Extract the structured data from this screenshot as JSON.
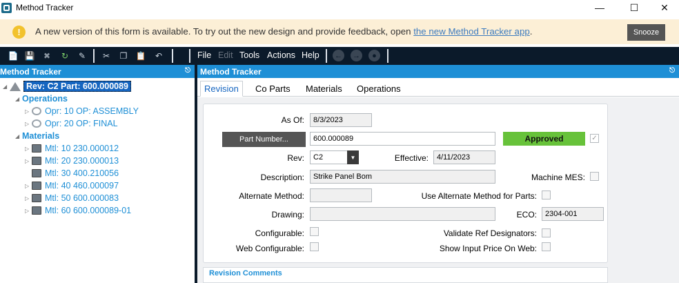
{
  "window": {
    "title": "Method Tracker"
  },
  "banner": {
    "text": "A new version of this form is available. To try out the new design and provide feedback, open ",
    "link": "the new Method Tracker app",
    "end": ".",
    "snooze": "Snooze"
  },
  "menu": {
    "file": "File",
    "edit": "Edit",
    "tools": "Tools",
    "actions": "Actions",
    "help": "Help"
  },
  "left_panel": {
    "title": "Method Tracker",
    "root": "Rev: C2 Part: 600.000089",
    "operations_label": "Operations",
    "operations": [
      "Opr: 10 OP: ASSEMBLY",
      "Opr: 20 OP: FINAL"
    ],
    "materials_label": "Materials",
    "materials": [
      "Mtl: 10 230.000012",
      "Mtl: 20 230.000013",
      "Mtl: 30 400.210056",
      "Mtl: 40 460.000097",
      "Mtl: 50 600.000083",
      "Mtl: 60 600.000089-01"
    ]
  },
  "right_panel": {
    "title": "Method Tracker",
    "tabs": [
      "Revision",
      "Co Parts",
      "Materials",
      "Operations"
    ],
    "active_tab": "Revision"
  },
  "form": {
    "as_of_label": "As Of:",
    "as_of": "8/3/2023",
    "part_number_button": "Part Number...",
    "part_number": "600.000089",
    "status": "Approved",
    "rev_label": "Rev:",
    "rev": "C2",
    "effective_label": "Effective:",
    "effective": "4/11/2023",
    "description_label": "Description:",
    "description": "Strike Panel Bom",
    "machine_mes_label": "Machine MES:",
    "alternate_method_label": "Alternate Method:",
    "alternate_method": "",
    "use_alt_label": "Use Alternate Method for Parts:",
    "drawing_label": "Drawing:",
    "drawing": "",
    "eco_label": "ECO:",
    "eco": "2304-001",
    "configurable_label": "Configurable:",
    "validate_ref_label": "Validate Ref Designators:",
    "web_configurable_label": "Web Configurable:",
    "show_input_price_label": "Show Input Price On Web:",
    "revision_comments_label": "Revision Comments"
  },
  "colors": {
    "accent": "#1e8fd6",
    "approved": "#67c23a",
    "toolbar": "#0b1a2a",
    "banner": "#fcefd6"
  }
}
